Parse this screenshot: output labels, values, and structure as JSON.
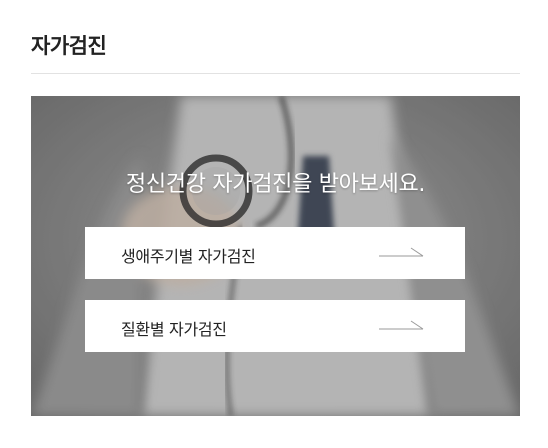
{
  "section": {
    "title": "자가검진"
  },
  "banner": {
    "heading": "정신건강 자가검진을 받아보세요.",
    "buttons": [
      {
        "label": "생애주기별 자가검진",
        "icon": "arrow-right-icon"
      },
      {
        "label": "질환별 자가검진",
        "icon": "arrow-right-icon"
      }
    ]
  },
  "colors": {
    "button_bg": "#ffffff",
    "heading_text": "#ffffff",
    "arrow": "#9a9a9a"
  }
}
